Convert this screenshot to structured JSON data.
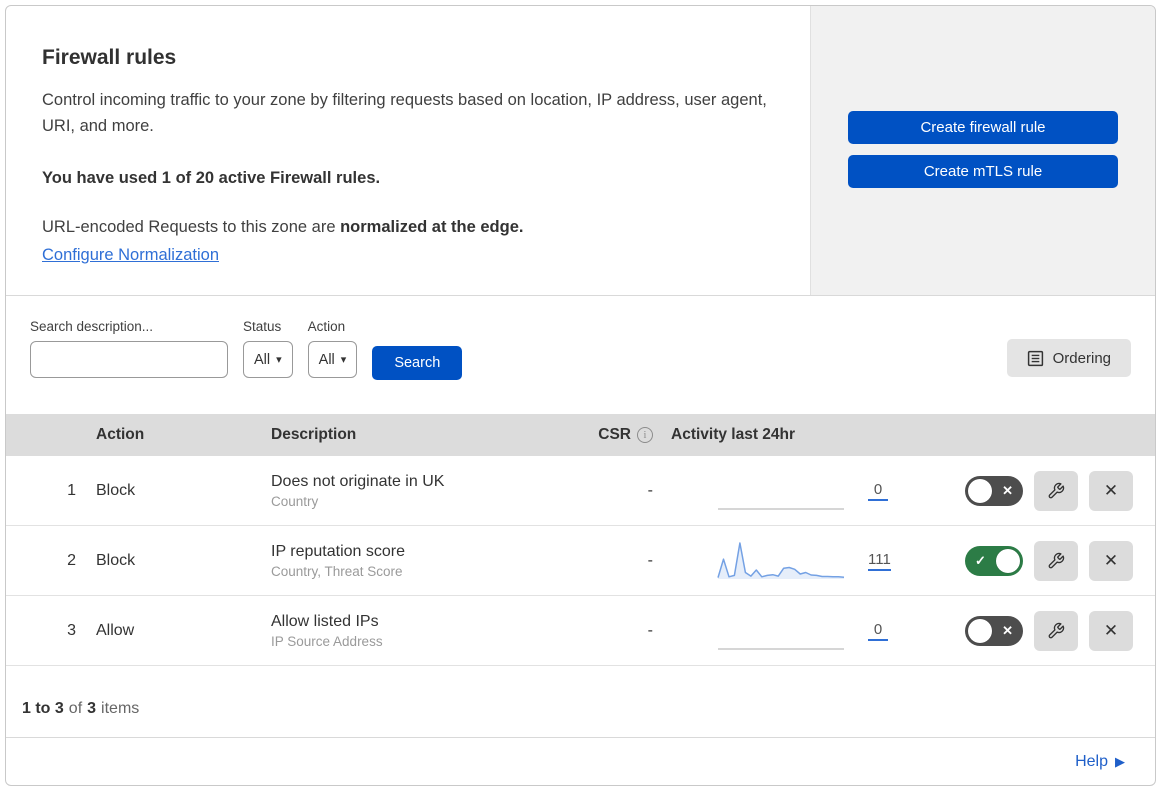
{
  "hero": {
    "title": "Firewall rules",
    "description": "Control incoming traffic to your zone by filtering requests based on location, IP address, user agent, URI, and more.",
    "usage": "You have used 1 of 20 active Firewall rules.",
    "normalization_prefix": "URL-encoded Requests to this zone are ",
    "normalization_bold": "normalized at the edge.",
    "link": "Configure Normalization",
    "create_firewall_button": "Create firewall rule",
    "create_mtls_button": "Create mTLS rule"
  },
  "filters": {
    "search_label": "Search description...",
    "search_value": "",
    "status_label": "Status",
    "status_value": "All",
    "action_label": "Action",
    "action_value": "All",
    "search_button": "Search",
    "ordering_button": "Ordering"
  },
  "table": {
    "headers": {
      "action": "Action",
      "description": "Description",
      "csr": "CSR",
      "activity": "Activity last 24hr"
    },
    "rows": [
      {
        "index": "1",
        "action": "Block",
        "description": "Does not originate in UK",
        "criteria": "Country",
        "csr": "-",
        "count": "0",
        "enabled": false,
        "sparkline": []
      },
      {
        "index": "2",
        "action": "Block",
        "description": "IP reputation score",
        "criteria": "Country, Threat Score",
        "csr": "-",
        "count": "111",
        "enabled": true,
        "sparkline": [
          4,
          55,
          6,
          10,
          100,
          18,
          8,
          25,
          6,
          10,
          12,
          8,
          30,
          32,
          27,
          14,
          18,
          11,
          10,
          7,
          7,
          6,
          6,
          5
        ]
      },
      {
        "index": "3",
        "action": "Allow",
        "description": "Allow listed IPs",
        "criteria": "IP Source Address",
        "csr": "-",
        "count": "0",
        "enabled": false,
        "sparkline": []
      }
    ]
  },
  "footer": {
    "range": "1 to 3",
    "of_label": "of",
    "total": "3",
    "items_label": "items",
    "help": "Help"
  },
  "icons": {
    "caret": "▾",
    "check": "✓",
    "x": "✕",
    "info": "i",
    "help_arrow": "▶"
  },
  "colors": {
    "accent": "#0051c3",
    "link": "#2f6fd6",
    "toggle-on": "#2c7c46",
    "toggle-off": "#4d4d4d",
    "header-bg": "#dcdcdc",
    "panel-bg": "#f1f1f1",
    "btn-gray": "#dcdcdc",
    "sparkline": "#74a1e4"
  }
}
